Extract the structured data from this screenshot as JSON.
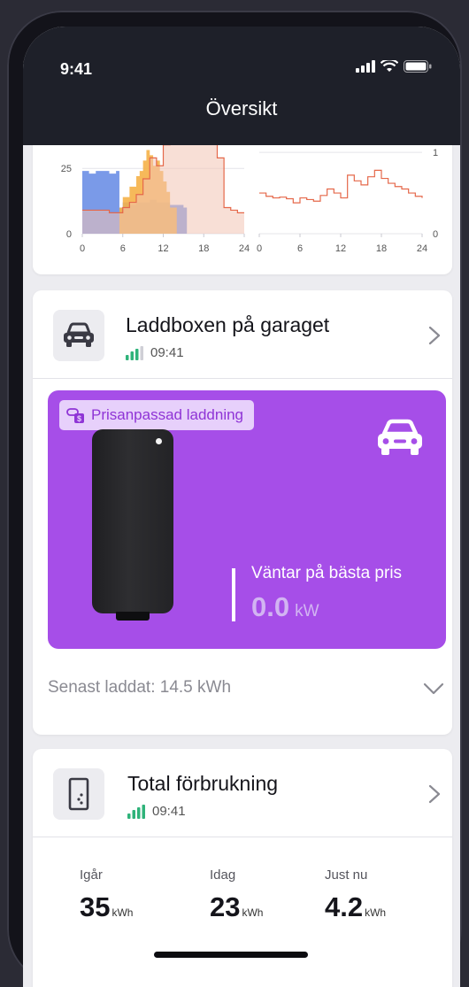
{
  "status_bar": {
    "time": "9:41",
    "icons": [
      "signal-icon",
      "wifi-icon",
      "battery-icon"
    ]
  },
  "nav": {
    "title": "Översikt"
  },
  "chart_data": [
    {
      "type": "area",
      "x_ticks": [
        "0",
        "6",
        "12",
        "18",
        "24"
      ],
      "y_ticks": [
        "0",
        "25"
      ],
      "ylim": [
        0,
        42
      ],
      "xlim": [
        0,
        24
      ],
      "series": [
        {
          "color": "#6b8fe6",
          "x": [
            0,
            0.5,
            1,
            2,
            3,
            4,
            5,
            5.5,
            6,
            7,
            8,
            9,
            10,
            11,
            12,
            13,
            14,
            15,
            15.5
          ],
          "values": [
            24,
            24,
            23,
            24,
            24,
            23,
            24,
            10,
            12,
            11,
            12,
            12,
            13,
            12,
            12,
            11,
            11,
            10,
            0
          ]
        },
        {
          "color": "#f5b148",
          "x": [
            4.5,
            5.5,
            6,
            7,
            8,
            8.5,
            9,
            9.5,
            10,
            10.5,
            11,
            11.5,
            12,
            12.5,
            13,
            14
          ],
          "values": [
            0,
            10,
            14,
            18,
            22,
            24,
            28,
            32,
            30,
            26,
            28,
            24,
            20,
            16,
            10,
            0
          ]
        },
        {
          "color": "#f3c4b4",
          "line_color": "#e5684a",
          "x": [
            0,
            2,
            4,
            5,
            6,
            7,
            8,
            9,
            10,
            11,
            12,
            13,
            14,
            15,
            16,
            17,
            18,
            19,
            20,
            21,
            22,
            23,
            24
          ],
          "values": [
            9,
            9,
            8,
            8,
            10,
            12,
            15,
            21,
            29,
            26,
            34,
            38,
            37,
            38,
            40,
            42,
            39,
            40,
            29,
            10,
            9,
            8,
            8
          ]
        }
      ]
    },
    {
      "type": "line",
      "x_ticks": [
        "0",
        "6",
        "12",
        "18",
        "24"
      ],
      "y_ticks": [
        "0",
        "1"
      ],
      "ylim": [
        0,
        1.35
      ],
      "xlim": [
        0,
        24
      ],
      "series": [
        {
          "color": "#e5684a",
          "x": [
            0,
            1,
            2,
            3,
            4,
            5,
            6,
            7,
            8,
            9,
            10,
            11,
            12,
            13,
            14,
            15,
            16,
            17,
            18,
            19,
            20,
            21,
            22,
            23,
            24
          ],
          "values": [
            0.5,
            0.46,
            0.44,
            0.45,
            0.43,
            0.38,
            0.44,
            0.42,
            0.4,
            0.47,
            0.55,
            0.5,
            0.44,
            0.72,
            0.65,
            0.6,
            0.7,
            0.78,
            0.68,
            0.62,
            0.58,
            0.55,
            0.5,
            0.46,
            0.44
          ]
        }
      ]
    }
  ],
  "charger": {
    "title": "Laddboxen på garaget",
    "time": "09:41",
    "mode_badge": "Prisanpassad laddning",
    "status": "Väntar på bästa pris",
    "power_value": "0.0",
    "power_unit": "kW",
    "last_charged": "Senast laddat: 14.5 kWh",
    "colors": {
      "panel": "#a64ee8",
      "badge_bg": "#e7d0fb",
      "badge_text": "#8f34d6"
    }
  },
  "consumption": {
    "title": "Total förbrukning",
    "time": "09:41",
    "stats": [
      {
        "label": "Igår",
        "value": "35",
        "unit": "kWh"
      },
      {
        "label": "Idag",
        "value": "23",
        "unit": "kWh"
      },
      {
        "label": "Just nu",
        "value": "4.2",
        "unit": "kWh"
      }
    ]
  },
  "colors": {
    "signal_green": "#2fb37a",
    "topbar": "#1e2029"
  }
}
